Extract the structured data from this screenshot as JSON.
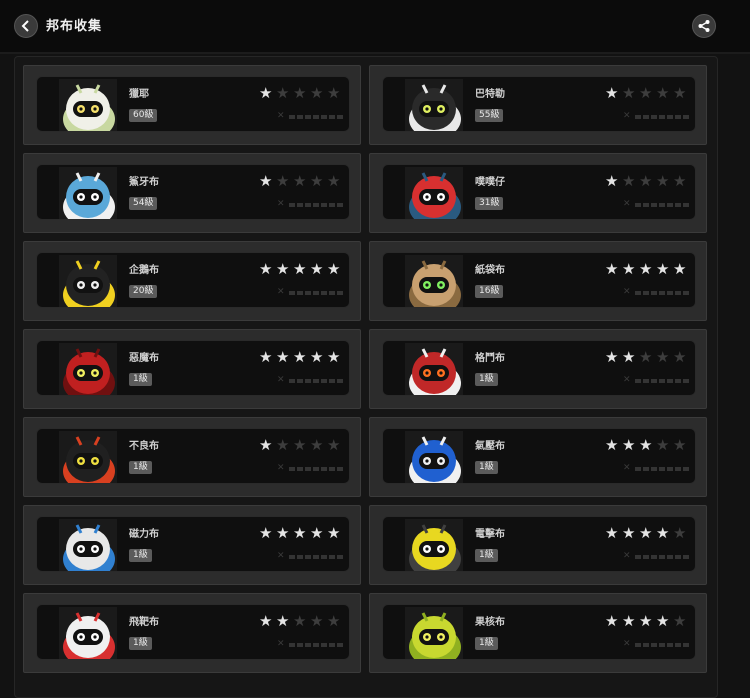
{
  "header": {
    "title": "邦布收集"
  },
  "bangboos": [
    {
      "name": "獵耶",
      "level": "60級",
      "stars": 1,
      "body": "#f0f0e8",
      "accent": "#c8d8a0",
      "eye": "#f5e06a"
    },
    {
      "name": "巴特勒",
      "level": "55級",
      "stars": 1,
      "body": "#2a2a2a",
      "accent": "#e8e8e8",
      "eye": "#e0f060"
    },
    {
      "name": "鯊牙布",
      "level": "54級",
      "stars": 1,
      "body": "#5aa8d8",
      "accent": "#f0f0f0",
      "eye": "#ffffff"
    },
    {
      "name": "噗噗仔",
      "level": "31級",
      "stars": 1,
      "body": "#d83030",
      "accent": "#2a5a80",
      "eye": "#ffffff"
    },
    {
      "name": "企鵝布",
      "level": "20級",
      "stars": 5,
      "body": "#222222",
      "accent": "#f0d020",
      "eye": "#f0f0f0"
    },
    {
      "name": "紙袋布",
      "level": "16級",
      "stars": 5,
      "body": "#c8a070",
      "accent": "#8a6a40",
      "eye": "#80f060"
    },
    {
      "name": "惡魔布",
      "level": "1級",
      "stars": 5,
      "body": "#c02020",
      "accent": "#701010",
      "eye": "#f0f060"
    },
    {
      "name": "格鬥布",
      "level": "1級",
      "stars": 2,
      "body": "#c02828",
      "accent": "#f0f0f0",
      "eye": "#ff7020"
    },
    {
      "name": "不良布",
      "level": "1級",
      "stars": 1,
      "body": "#202020",
      "accent": "#d84020",
      "eye": "#f0e040"
    },
    {
      "name": "氣壓布",
      "level": "1級",
      "stars": 3,
      "body": "#2060d0",
      "accent": "#f0f0f0",
      "eye": "#f0f0f0"
    },
    {
      "name": "磁力布",
      "level": "1級",
      "stars": 5,
      "body": "#e8e8e8",
      "accent": "#3080d0",
      "eye": "#ffffff"
    },
    {
      "name": "電擊布",
      "level": "1級",
      "stars": 4,
      "body": "#e8d820",
      "accent": "#404040",
      "eye": "#ffffff"
    },
    {
      "name": "飛靶布",
      "level": "1級",
      "stars": 2,
      "body": "#f0f0f0",
      "accent": "#d83030",
      "eye": "#ffffff"
    },
    {
      "name": "果核布",
      "level": "1級",
      "stars": 4,
      "body": "#c8d830",
      "accent": "#90b020",
      "eye": "#f0f060"
    }
  ],
  "max_stars": 5
}
